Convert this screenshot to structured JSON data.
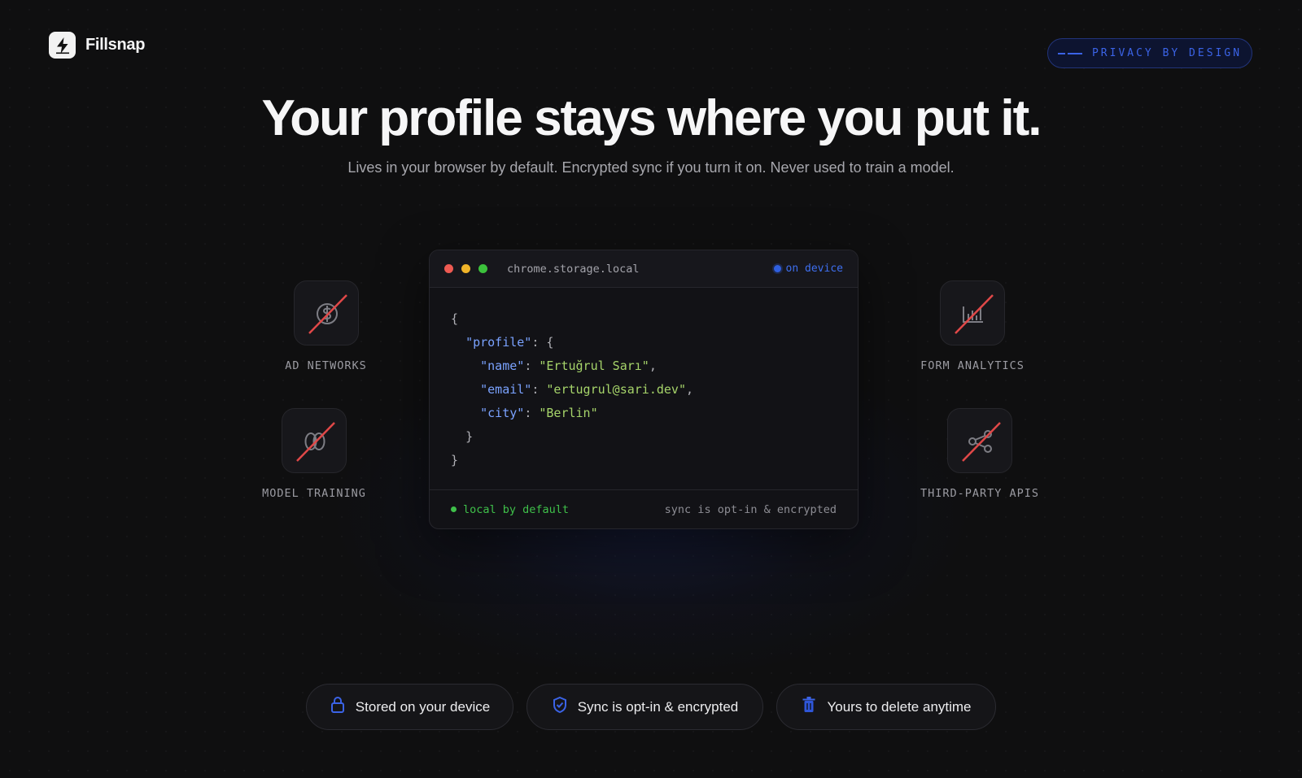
{
  "brand": {
    "name": "Fillsnap",
    "logo_icon": "lightning-bolt-icon"
  },
  "badge": {
    "label": "PRIVACY BY DESIGN",
    "color": "#3b63e6"
  },
  "hero": {
    "title": "Your profile stays where you put it.",
    "subtitle": "Lives in your browser by default. Encrypted sync if you turn it on. Never used to train a model."
  },
  "code_window": {
    "filename": "chrome.storage.local",
    "status": "on device",
    "lines": {
      "open": "{",
      "profile_key": "\"profile\"",
      "profile_colon": ": {",
      "name_key": "\"name\"",
      "name_value": "\"Ertuğrul Sarı\"",
      "email_key": "\"email\"",
      "email_value": "\"ertugrul@sari.dev\"",
      "city_key": "\"city\"",
      "city_value": "\"Berlin\"",
      "inner_close": "}",
      "close": "}"
    },
    "footer_left": "local by default",
    "footer_right": "sync is opt-in & encrypted"
  },
  "blocked": [
    {
      "label": "AD NETWORKS",
      "icon": "dollar-icon"
    },
    {
      "label": "MODEL TRAINING",
      "icon": "brain-icon"
    },
    {
      "label": "FORM ANALYTICS",
      "icon": "bar-chart-icon"
    },
    {
      "label": "THIRD-PARTY APIS",
      "icon": "share-icon"
    }
  ],
  "features": [
    {
      "label": "Stored on your device",
      "icon": "lock-icon"
    },
    {
      "label": "Sync is opt-in & encrypted",
      "icon": "shield-check-icon"
    },
    {
      "label": "Yours to delete anytime",
      "icon": "trash-icon"
    }
  ],
  "colors": {
    "accent": "#3b63e6",
    "strike": "#e04848",
    "json_key": "#7aa2ff",
    "json_string": "#a6d46a",
    "ok_green": "#3fc04a"
  }
}
